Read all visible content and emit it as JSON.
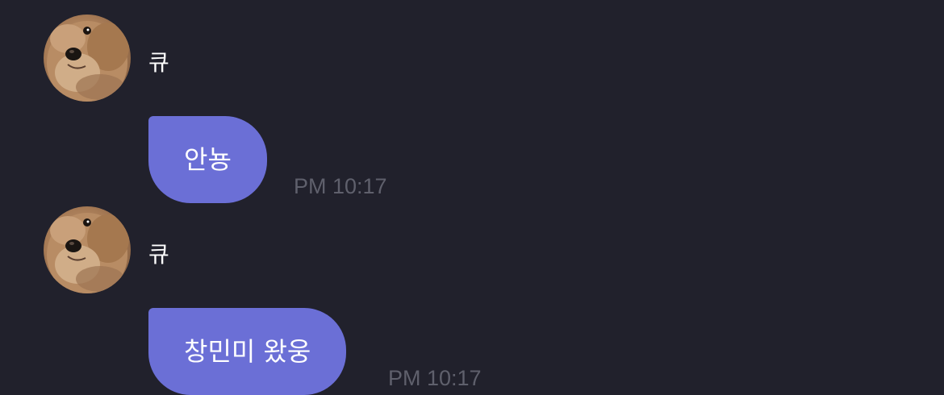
{
  "colors": {
    "background": "#21212c",
    "bubble": "#6b6fd6",
    "timestamp": "#5f606c",
    "text": "#ffffff"
  },
  "messages": [
    {
      "sender": "큐",
      "avatar_icon": "dog-avatar",
      "text": "안뇽",
      "time": "PM 10:17"
    },
    {
      "sender": "큐",
      "avatar_icon": "dog-avatar",
      "text": "창민미 왔웅",
      "time": "PM 10:17"
    }
  ]
}
